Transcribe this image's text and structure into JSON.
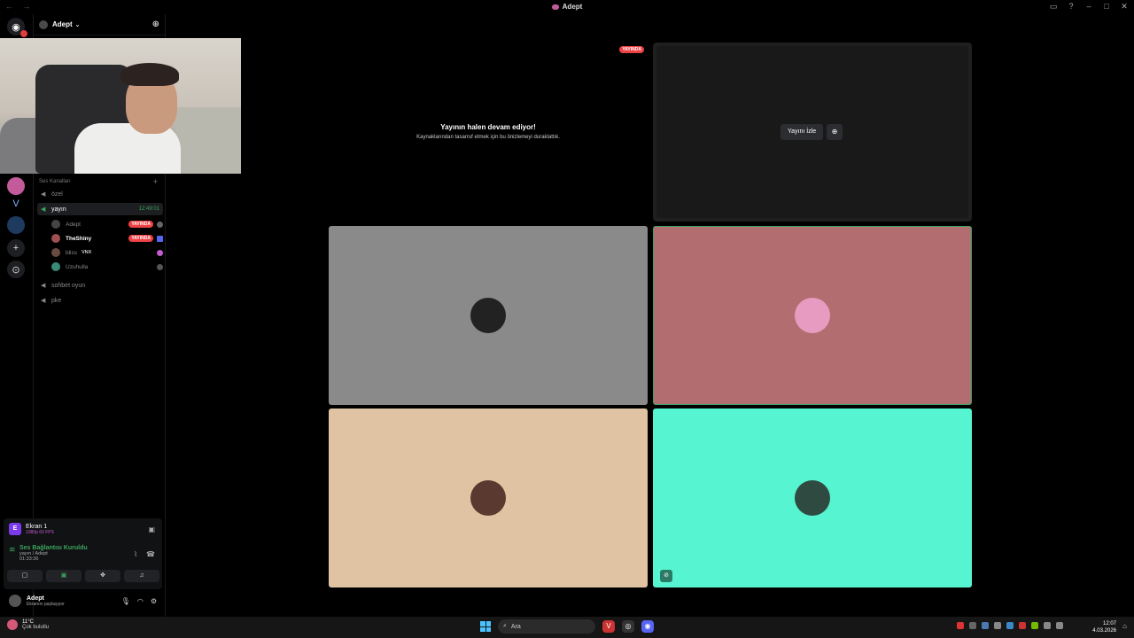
{
  "window": {
    "title": "Adept",
    "nav": "← →"
  },
  "server": {
    "name": "Adept",
    "category": "Ses Kanalları"
  },
  "channels": [
    {
      "name": "özel"
    },
    {
      "name": "yayın",
      "time": "12:49:01"
    },
    {
      "name": "sohbet oyun"
    },
    {
      "name": "pke"
    }
  ],
  "voice_users": [
    {
      "name": "Adept",
      "live": "YAYINDA"
    },
    {
      "name": "TheShiny",
      "live": "YAYINDA"
    },
    {
      "name": "bliss",
      "tag": "VNX"
    },
    {
      "name": "Uzuhulla"
    }
  ],
  "stream_notice": {
    "live_tag": "YAYINDA",
    "heading": "Yayının halen devam ediyor!",
    "body": "Kaynaklarından tasarruf etmek için bu önizlemeyi duraklattık."
  },
  "preview": {
    "watch_label": "Yayını İzle"
  },
  "tiles": [
    {
      "color": "#8a8a8a",
      "avatar_color": "#222222"
    },
    {
      "color": "#b26d70",
      "avatar_color": "#e89bc0"
    },
    {
      "color": "#dfc3a3",
      "avatar_color": "#5a3a30"
    },
    {
      "color": "#56f4d0",
      "avatar_color": "#2f4a40"
    }
  ],
  "rtc": {
    "screen_name": "Ekran 1",
    "screen_sub": "1080p 60 FPS",
    "screen_initial": "E",
    "conn_title": "Ses Bağlantısı Kuruldu",
    "conn_sub": "yayın / Adept",
    "conn_time": "01:33:36"
  },
  "user_panel": {
    "name": "Adept",
    "status": "Ekranını paylaşıyor"
  },
  "taskbar": {
    "temp": "11°C",
    "condition": "Çok bulutlu",
    "search": "Ara",
    "time": "12:07",
    "date": "4.03.2026"
  },
  "colors": {
    "accent_green": "#3ba55d",
    "live_red": "#ed4245"
  }
}
